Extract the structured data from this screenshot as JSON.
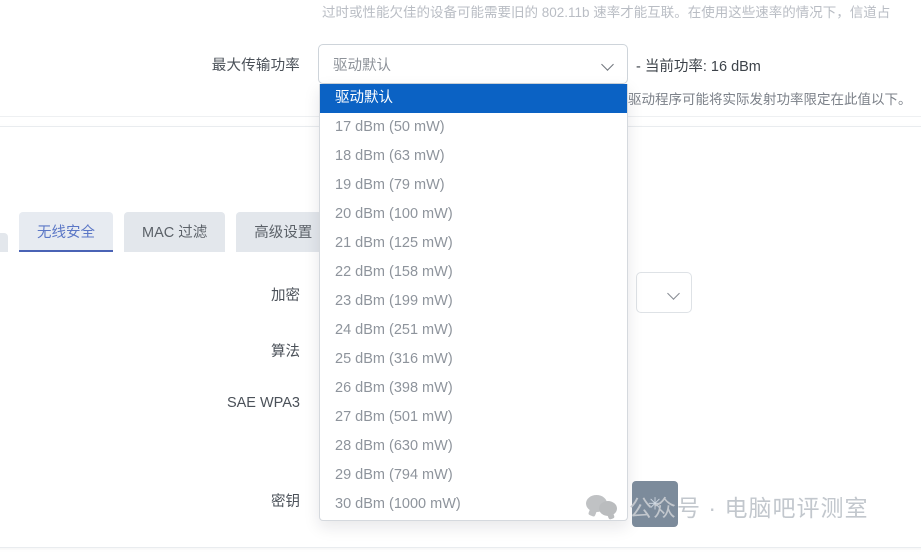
{
  "top_note": {
    "text": "过时或性能欠佳的设备可能需要旧的 802.11b 速率才能互联。在使用这些速率的情况下，信道占"
  },
  "power_field": {
    "label": "最大传输功率",
    "selected_value": "驱动默认",
    "chevron_icon": "chevron-down-icon",
    "current_power_text": "- 当前功率: 16 dBm",
    "hint": "驱动程序可能将实际发射功率限定在此值以下。"
  },
  "dropdown": {
    "options": [
      {
        "label": "驱动默认",
        "selected": true
      },
      {
        "label": "17 dBm (50 mW)",
        "selected": false
      },
      {
        "label": "18 dBm (63 mW)",
        "selected": false
      },
      {
        "label": "19 dBm (79 mW)",
        "selected": false
      },
      {
        "label": "20 dBm (100 mW)",
        "selected": false
      },
      {
        "label": "21 dBm (125 mW)",
        "selected": false
      },
      {
        "label": "22 dBm (158 mW)",
        "selected": false
      },
      {
        "label": "23 dBm (199 mW)",
        "selected": false
      },
      {
        "label": "24 dBm (251 mW)",
        "selected": false
      },
      {
        "label": "25 dBm (316 mW)",
        "selected": false
      },
      {
        "label": "26 dBm (398 mW)",
        "selected": false
      },
      {
        "label": "27 dBm (501 mW)",
        "selected": false
      },
      {
        "label": "28 dBm (630 mW)",
        "selected": false
      },
      {
        "label": "29 dBm (794 mW)",
        "selected": false
      },
      {
        "label": "30 dBm (1000 mW)",
        "selected": false
      }
    ],
    "highlight_color": "#0b62c4"
  },
  "tabs": [
    {
      "label": "",
      "active": false,
      "cut": true
    },
    {
      "label": "无线安全",
      "active": true,
      "cut": false
    },
    {
      "label": "MAC 过滤",
      "active": false,
      "cut": false
    },
    {
      "label": "高级设置",
      "active": false,
      "cut": false
    }
  ],
  "security_form": {
    "labels": {
      "encryption": "加密",
      "algorithm": "算法",
      "sae_wpa3": "SAE WPA3",
      "key": "密钥"
    },
    "encryption_chevron_icon": "chevron-down-icon"
  },
  "watermark": {
    "icon": "wechat-icon",
    "text": "公众号 · 电脑吧评测室"
  },
  "overlay": {
    "star_glyph": "✳"
  }
}
